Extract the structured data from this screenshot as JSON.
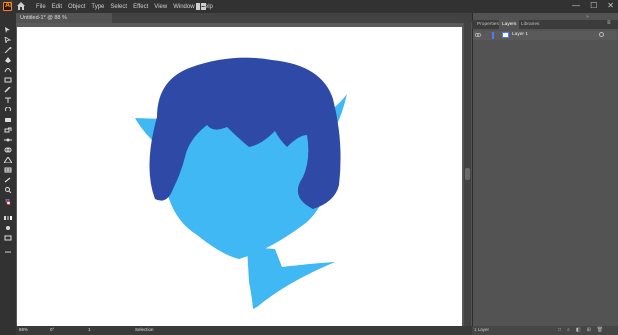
{
  "app": {
    "icon_text": "Ai"
  },
  "menu": [
    "File",
    "Edit",
    "Object",
    "Type",
    "Select",
    "Effect",
    "View",
    "Window",
    "Help"
  ],
  "document_tab": {
    "title": "Untitled-1* @ 88 % (CMYK/Preview)",
    "close": "×"
  },
  "window_controls": {
    "minimize": "—",
    "maximize": "☐",
    "close": "✕"
  },
  "panel": {
    "tabs": [
      "Properties",
      "Layers",
      "Libraries"
    ],
    "active_tab": "Layers",
    "menu": "≡",
    "collapse": "»",
    "layer": {
      "name": "Layer 1",
      "color": "#4f7cff"
    },
    "layers_count": "1 Layer"
  },
  "status": {
    "zoom": "88%",
    "angle": "0°",
    "artboard": "1",
    "mode": "Selection"
  },
  "colors": {
    "hair": "#2e4aa6",
    "skin": "#3fb8f4",
    "accent": "#ff7b2a"
  }
}
